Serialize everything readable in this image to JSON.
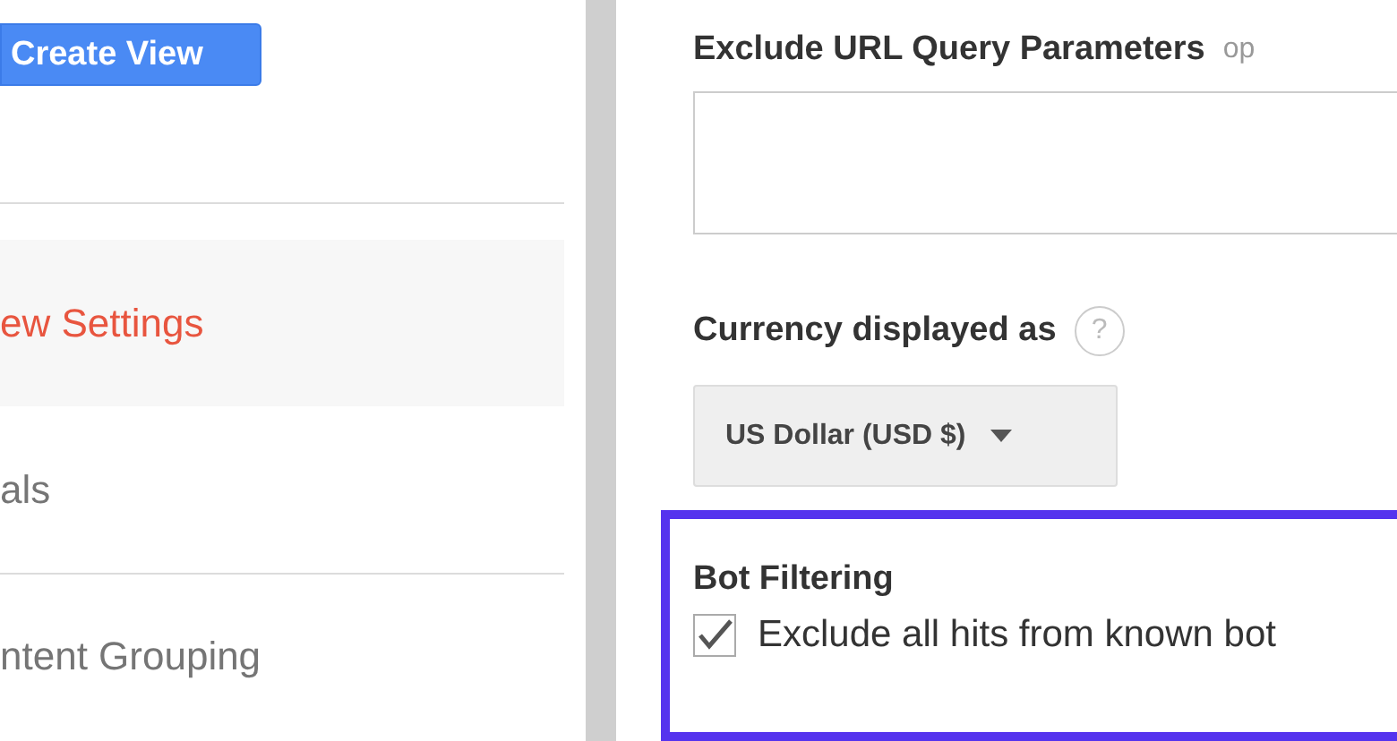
{
  "create_button": {
    "label": "Create View"
  },
  "sidebar": {
    "items": [
      {
        "label": "ew Settings",
        "selected": true
      },
      {
        "label": "als",
        "selected": false
      },
      {
        "label": "ntent Grouping",
        "selected": false
      }
    ]
  },
  "exclude_params": {
    "label": "Exclude URL Query Parameters",
    "hint": "op"
  },
  "currency": {
    "label": "Currency displayed as",
    "help": "?",
    "value": "US Dollar (USD $)"
  },
  "bot_filtering": {
    "title": "Bot Filtering",
    "option": {
      "label": "Exclude all hits from known bot",
      "checked": true
    }
  }
}
